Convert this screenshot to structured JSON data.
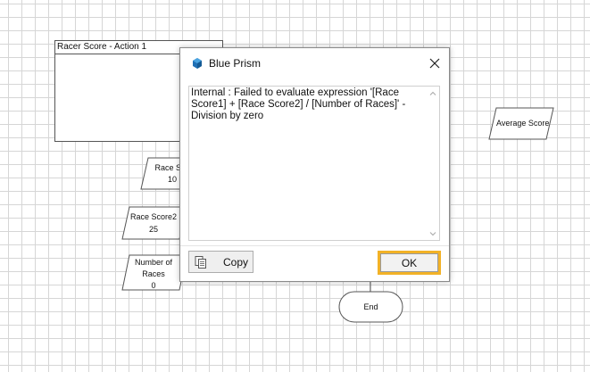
{
  "canvas": {
    "process_title": "Racer Score - Action 1",
    "stages": {
      "race_score1": {
        "label_line1": "Race Sco",
        "label_line2": "10"
      },
      "race_score2": {
        "label_line1": "Race Score2",
        "label_line2": "25"
      },
      "number_of_races": {
        "label_line1": "Number of",
        "label_line2": "Races",
        "label_line3": "0"
      },
      "average_score": {
        "label": "Average Score"
      },
      "end": {
        "label": "End"
      }
    }
  },
  "dialog": {
    "title": "Blue Prism",
    "message": "Internal : Failed to evaluate expression '[Race Score1] + [Race Score2] / [Number of Races]' - Division by zero",
    "copy_label": "Copy",
    "ok_label": "OK",
    "icon": "blue-prism-icon",
    "accent": "#f2b227"
  }
}
